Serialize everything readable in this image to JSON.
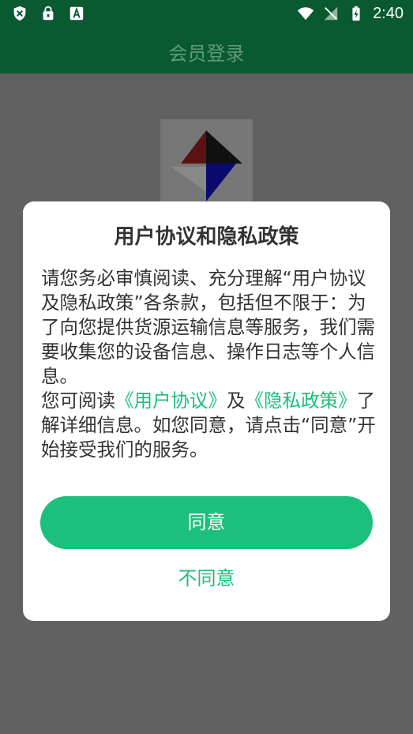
{
  "status_bar": {
    "time": "2:40",
    "left_icons": [
      "shield-x-icon",
      "lock-app-icon",
      "text-app-icon"
    ],
    "right_icons": [
      "wifi-icon",
      "no-signal-icon",
      "battery-charging-icon"
    ]
  },
  "app_bar": {
    "title": "会员登录"
  },
  "dialog": {
    "title": "用户协议和隐私政策",
    "paragraph1": "请您务必审慎阅读、充分理解“用户协议及隐私政策”各条款，包括但不限于：为了向您提供货源运输信息等服务，我们需要收集您的设备信息、操作日志等个人信息。",
    "p2_prefix": "您可阅读",
    "user_agreement_link": "《用户协议》",
    "p2_and": "及",
    "privacy_policy_link": "《隐私政策》",
    "p2_suffix": "了解详细信息。如您同意，请点击“同意”开始接受我们的服务。",
    "agree_label": "同意",
    "disagree_label": "不同意"
  },
  "colors": {
    "primary_dark": "#0a5a31",
    "accent_green": "#1cbf7b",
    "overlay_gray": "#616161"
  }
}
